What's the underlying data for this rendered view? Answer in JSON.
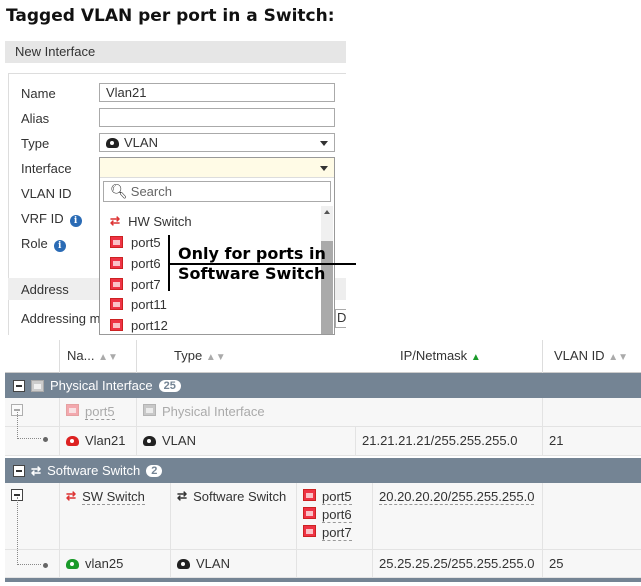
{
  "title": "Tagged VLAN per port in a Switch:",
  "panel": {
    "header": "New Interface",
    "section_address": "Address",
    "addressing_label": "Addressing m",
    "addressing_value_fragment": "D"
  },
  "form": {
    "name_label": "Name",
    "name_value": "Vlan21",
    "alias_label": "Alias",
    "alias_value": "",
    "type_label": "Type",
    "type_value": "VLAN",
    "interface_label": "Interface",
    "interface_value": "",
    "vlanid_label": "VLAN ID",
    "vrfid_label": "VRF ID",
    "role_label": "Role"
  },
  "dropdown": {
    "search_placeholder": "Search",
    "items": [
      {
        "label": "HW Switch",
        "icon": "switch-icon"
      },
      {
        "label": "port5",
        "icon": "port-icon"
      },
      {
        "label": "port6",
        "icon": "port-icon"
      },
      {
        "label": "port7",
        "icon": "port-icon"
      },
      {
        "label": "port11",
        "icon": "port-icon"
      },
      {
        "label": "port12",
        "icon": "port-icon"
      }
    ]
  },
  "annotation": {
    "line1": "Only for ports in",
    "line2": "Software Switch"
  },
  "table": {
    "headers": {
      "name": "Na...",
      "type": "Type",
      "ip": "IP/Netmask",
      "vlan": "VLAN ID"
    },
    "groups": [
      {
        "label": "Physical Interface",
        "count": "25",
        "rows": [
          {
            "name": "port5",
            "type": "Physical Interface",
            "ip": "",
            "vlan": ""
          },
          {
            "name": "Vlan21",
            "type": "VLAN",
            "ip": "21.21.21.21/255.255.255.0",
            "vlan": "21"
          }
        ]
      },
      {
        "label": "Software Switch",
        "count": "2",
        "rows": [
          {
            "name": "SW Switch",
            "type": "Software Switch",
            "members": [
              "port5",
              "port6",
              "port7"
            ],
            "ip": "20.20.20.20/255.255.255.0",
            "vlan": ""
          },
          {
            "name": "vlan25",
            "type": "VLAN",
            "ip": "25.25.25.25/255.255.255.0",
            "vlan": "25"
          }
        ]
      }
    ]
  },
  "colors": {
    "group_bar": "#748494",
    "port_red": "#e33344",
    "vlan_green": "#1a9a2a",
    "sort_active": "#1a9a2a"
  }
}
